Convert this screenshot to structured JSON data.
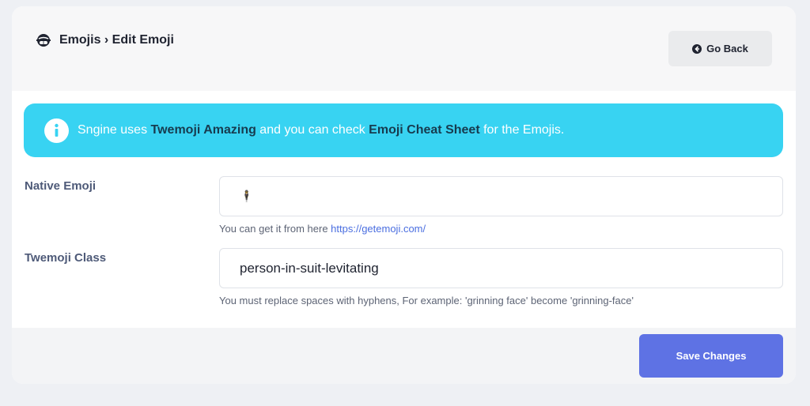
{
  "header": {
    "icon": "grinning-face-icon",
    "title": "Emojis › Edit Emoji",
    "go_back_label": "Go Back",
    "go_back_icon": "arrow-left-circle-icon"
  },
  "alert": {
    "icon": "info-icon",
    "text_prefix": "Sngine uses ",
    "link1": "Twemoji Amazing",
    "text_middle": " and you can check ",
    "link2": "Emoji Cheat Sheet",
    "text_suffix": " for the Emojis.",
    "color": "#38d3f2"
  },
  "form": {
    "native_emoji": {
      "label": "Native Emoji",
      "value": "🕴",
      "help_text": "You can get it from here ",
      "help_link": "https://getemoji.com/"
    },
    "twemoji_class": {
      "label": "Twemoji Class",
      "value": "person-in-suit-levitating",
      "help_text": "You must replace spaces with hyphens, For example: 'grinning face' become 'grinning-face'"
    }
  },
  "footer": {
    "save_label": "Save Changes",
    "accent": "#5e72e4"
  }
}
